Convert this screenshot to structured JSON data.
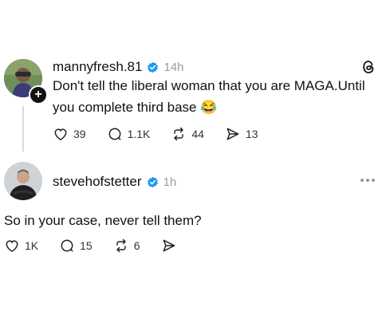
{
  "post": {
    "username": "mannyfresh.81",
    "time": "14h",
    "text": "Don't tell the liberal woman that you are MAGA.Until you complete third base",
    "emoji": "😂",
    "actions": {
      "likes": "39",
      "comments": "1.1K",
      "reposts": "44",
      "shares": "13"
    }
  },
  "reply": {
    "username": "stevehofstetter",
    "time": "1h",
    "text": "So in your case, never tell them?",
    "actions": {
      "likes": "1K",
      "comments": "15",
      "reposts": "6"
    }
  },
  "colors": {
    "verified": "#1d9bf0",
    "muted": "#9a9a9a"
  },
  "icons": [
    "threads-logo-icon",
    "heart-icon",
    "comment-icon",
    "repost-icon",
    "share-icon",
    "more-icon",
    "verified-icon"
  ]
}
